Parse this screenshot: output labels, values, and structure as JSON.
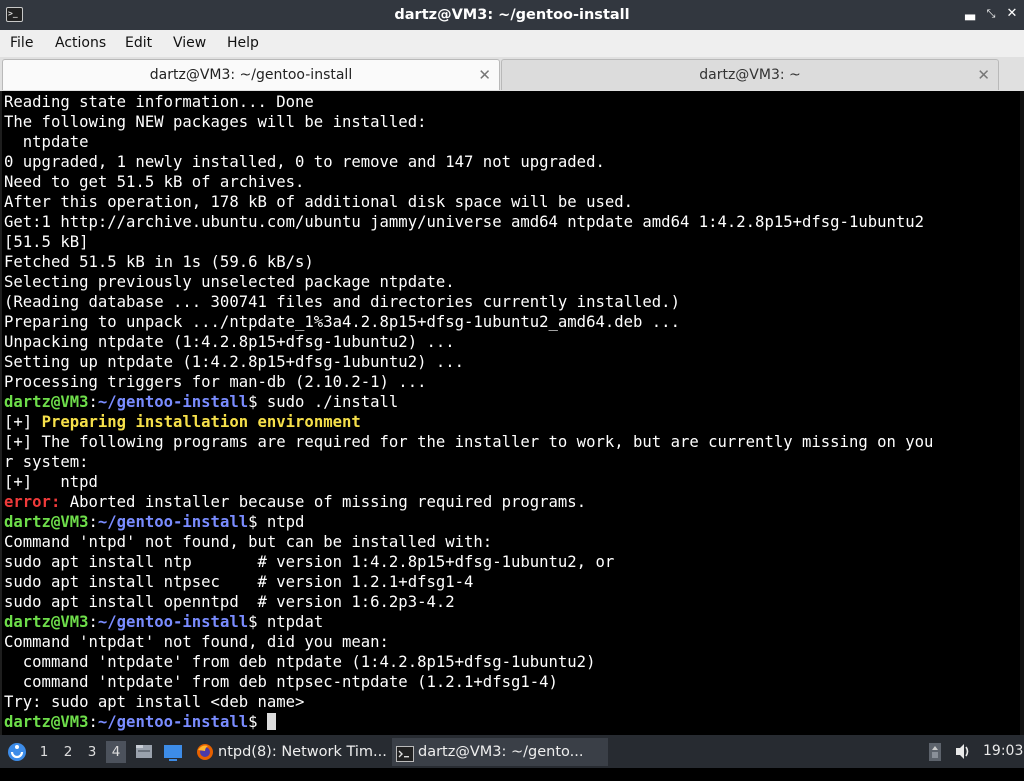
{
  "window": {
    "title": "dartz@VM3: ~/gentoo-install",
    "controls": [
      "minimize-icon",
      "restore-icon",
      "close-icon"
    ]
  },
  "menu": {
    "items": [
      "File",
      "Actions",
      "Edit",
      "View",
      "Help"
    ]
  },
  "tabs": [
    {
      "label": "dartz@VM3: ~/gentoo-install",
      "active": true
    },
    {
      "label": "dartz@VM3: ~",
      "active": false
    }
  ],
  "terminal": {
    "prompt": {
      "user_host": "dartz@VM3",
      "path": "~/gentoo-install"
    },
    "lines": [
      {
        "type": "out",
        "text": "Reading state information... Done"
      },
      {
        "type": "out",
        "text": "The following NEW packages will be installed:"
      },
      {
        "type": "out",
        "text": "  ntpdate"
      },
      {
        "type": "out",
        "text": "0 upgraded, 1 newly installed, 0 to remove and 147 not upgraded."
      },
      {
        "type": "out",
        "text": "Need to get 51.5 kB of archives."
      },
      {
        "type": "out",
        "text": "After this operation, 178 kB of additional disk space will be used."
      },
      {
        "type": "out",
        "text": "Get:1 http://archive.ubuntu.com/ubuntu jammy/universe amd64 ntpdate amd64 1:4.2.8p15+dfsg-1ubuntu2"
      },
      {
        "type": "out",
        "text": "[51.5 kB]"
      },
      {
        "type": "out",
        "text": "Fetched 51.5 kB in 1s (59.6 kB/s)"
      },
      {
        "type": "out",
        "text": "Selecting previously unselected package ntpdate."
      },
      {
        "type": "out",
        "text": "(Reading database ... 300741 files and directories currently installed.)"
      },
      {
        "type": "out",
        "text": "Preparing to unpack .../ntpdate_1%3a4.2.8p15+dfsg-1ubuntu2_amd64.deb ..."
      },
      {
        "type": "out",
        "text": "Unpacking ntpdate (1:4.2.8p15+dfsg-1ubuntu2) ..."
      },
      {
        "type": "out",
        "text": "Setting up ntpdate (1:4.2.8p15+dfsg-1ubuntu2) ..."
      },
      {
        "type": "out",
        "text": "Processing triggers for man-db (2.10.2-1) ..."
      },
      {
        "type": "prompt",
        "command": " sudo ./install"
      },
      {
        "type": "highlight",
        "prefix": "[+] ",
        "text": "Preparing installation environment"
      },
      {
        "type": "out",
        "text": "[+] The following programs are required for the installer to work, but are currently missing on you"
      },
      {
        "type": "out",
        "text": "r system:"
      },
      {
        "type": "out",
        "text": "[+]   ntpd"
      },
      {
        "type": "error",
        "prefix": "error:",
        "text": " Aborted installer because of missing required programs."
      },
      {
        "type": "prompt",
        "command": " ntpd"
      },
      {
        "type": "out",
        "text": "Command 'ntpd' not found, but can be installed with:"
      },
      {
        "type": "out",
        "text": "sudo apt install ntp       # version 1:4.2.8p15+dfsg-1ubuntu2, or"
      },
      {
        "type": "out",
        "text": "sudo apt install ntpsec    # version 1.2.1+dfsg1-4"
      },
      {
        "type": "out",
        "text": "sudo apt install openntpd  # version 1:6.2p3-4.2"
      },
      {
        "type": "prompt",
        "command": " ntpdat"
      },
      {
        "type": "out",
        "text": "Command 'ntpdat' not found, did you mean:"
      },
      {
        "type": "out",
        "text": "  command 'ntpdate' from deb ntpdate (1:4.2.8p15+dfsg-1ubuntu2)"
      },
      {
        "type": "out",
        "text": "  command 'ntpdate' from deb ntpsec-ntpdate (1.2.1+dfsg1-4)"
      },
      {
        "type": "out",
        "text": "Try: sudo apt install <deb name>"
      },
      {
        "type": "prompt-cursor",
        "command": " "
      }
    ]
  },
  "taskbar": {
    "workspaces": [
      "1",
      "2",
      "3",
      "4"
    ],
    "active_workspace": "4",
    "tasks": [
      {
        "label": "ntpd(8): Network Tim...",
        "icon": "firefox-icon"
      },
      {
        "label": "dartz@VM3: ~/gento...",
        "icon": "terminal-icon"
      }
    ],
    "clock": "19:03"
  },
  "colors": {
    "prompt_user": "#6ede4a",
    "prompt_path": "#7a8cff",
    "highlight": "#f6e04a",
    "error": "#ef3a3a"
  }
}
